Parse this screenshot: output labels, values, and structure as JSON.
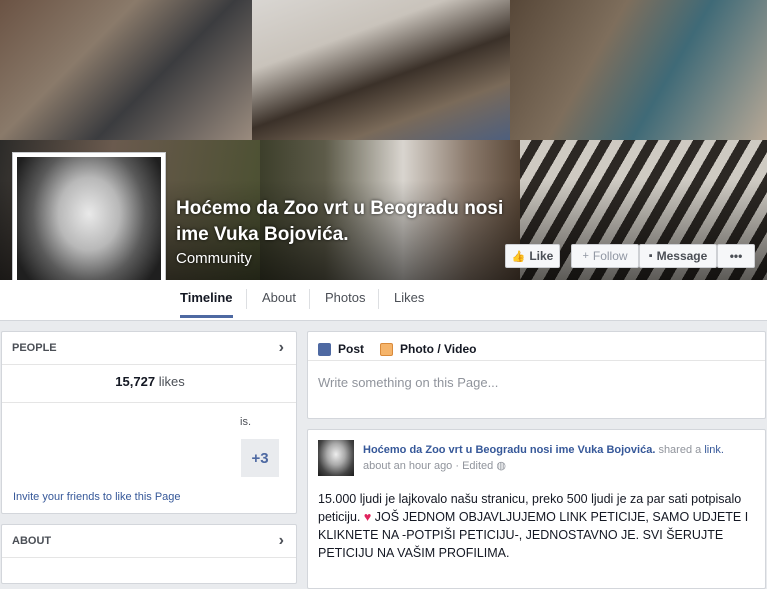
{
  "cover": {
    "page_name": "Hoćemo da Zoo vrt u Beogradu nosi ime Vuka Bojovića.",
    "category": "Community",
    "buttons": {
      "like": "Like",
      "follow": "Follow",
      "message": "Message",
      "more": "•••"
    }
  },
  "tabs": [
    "Timeline",
    "About",
    "Photos",
    "Likes"
  ],
  "people": {
    "header": "PEOPLE",
    "likes_count": "15,727",
    "likes_word": "likes",
    "friend_fragment": "is.",
    "more_count": "+3",
    "invite": "Invite your friends to like this Page"
  },
  "about": {
    "header": "ABOUT"
  },
  "composer": {
    "post_tab": "Post",
    "photo_tab": "Photo / Video",
    "placeholder": "Write something on this Page..."
  },
  "post": {
    "author": "Hoćemo da Zoo vrt u Beogradu nosi ime Vuka Bojovića.",
    "action": "shared a",
    "action_link": "link.",
    "time": "about an hour ago",
    "edited": "Edited",
    "text_before_heart": "15.000 ljudi je lajkovalo našu stranicu, preko 500 ljudi je za par sati potpisalo peticiju.",
    "heart": "♥",
    "text_after_heart": "JOŠ JEDNOM OBJAVLJUJEMO LINK PETICIJE, SAMO UDJETE I KLIKNETE NA -POTPIŠI PETICIJU-, JEDNOSTAVNO JE. SVI ŠERUJTE PETICIJU NA VAŠIM PROFILIMA."
  },
  "colors": {
    "brand_blue": "#4e69a2",
    "link_blue": "#365899",
    "background": "#e9ebee"
  },
  "icons": [
    "thumbs-up-icon",
    "plus-icon",
    "message-icon",
    "chevron-right-icon",
    "pencil-icon",
    "photo-icon",
    "globe-icon",
    "heart-icon"
  ]
}
